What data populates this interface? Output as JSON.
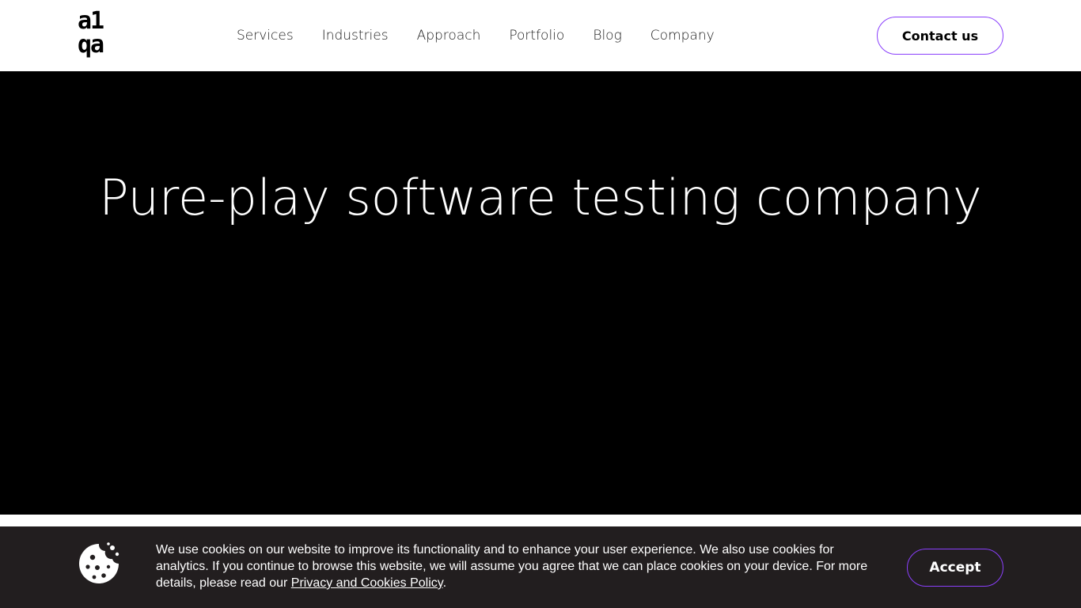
{
  "header": {
    "logo": {
      "line1": "a1",
      "line2": "qa"
    },
    "nav": [
      {
        "label": "Services"
      },
      {
        "label": "Industries"
      },
      {
        "label": "Approach"
      },
      {
        "label": "Portfolio"
      },
      {
        "label": "Blog"
      },
      {
        "label": "Company"
      }
    ],
    "contact_label": "Contact us"
  },
  "hero": {
    "title": "Pure-play software testing company"
  },
  "cookie": {
    "text_before": "We use cookies on our website to improve its functionality and to enhance your user experience. We also use cookies for analytics. If you continue to browse this website, we will assume you agree that we can place cookies on your device. For more details, please read our ",
    "link_label": "Privacy and Cookies Policy",
    "text_after": ".",
    "accept_label": "Accept",
    "icon": "cookie-icon"
  },
  "colors": {
    "accent": "#8a3ffc",
    "hero_bg": "#000000",
    "cookie_bg": "#221e1f"
  }
}
